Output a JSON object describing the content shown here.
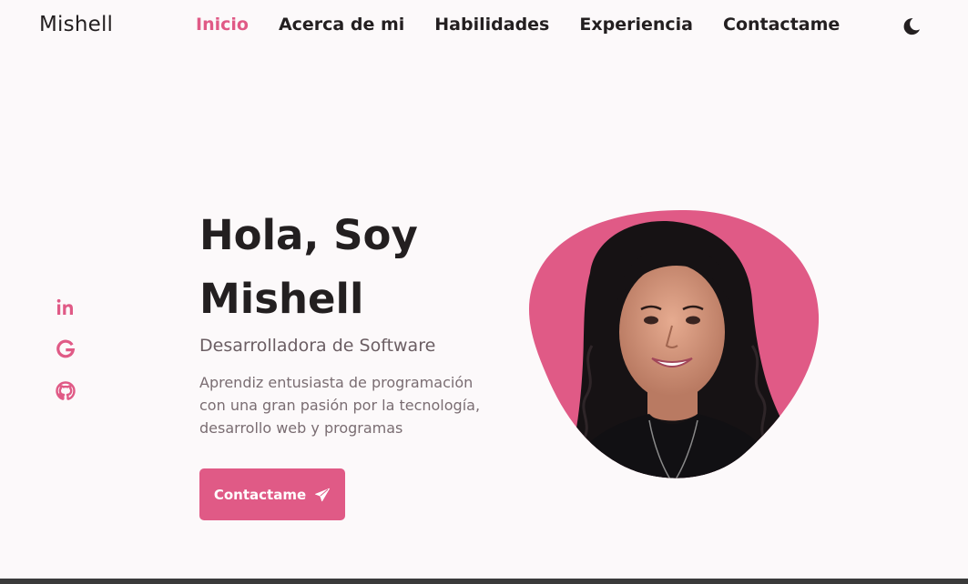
{
  "header": {
    "logo": "Mishell",
    "nav": [
      "Inicio",
      "Acerca de mi",
      "Habilidades",
      "Experiencia",
      "Contactame"
    ],
    "active_nav": "Inicio",
    "theme_icon": "moon-icon"
  },
  "social": [
    {
      "name": "linkedin-icon",
      "label": "in"
    },
    {
      "name": "google-icon",
      "label": "G"
    },
    {
      "name": "github-icon",
      "label": "github"
    }
  ],
  "hero": {
    "title_line1": "Hola, Soy",
    "title_line2": "Mishell",
    "subtitle": "Desarrolladora de Software",
    "description": "Aprendiz entusiasta de programación con una gran pasión por la tecnología, desarrollo web y programas",
    "cta_label": "Contactame",
    "cta_icon": "send-icon"
  },
  "colors": {
    "accent": "#e05a86",
    "text": "#231f20",
    "muted": "#6b5e63",
    "background": "#fcf9fa"
  }
}
